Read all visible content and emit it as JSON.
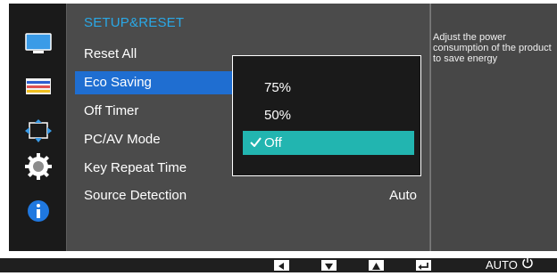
{
  "section_title": "SETUP&RESET",
  "menu_items": [
    {
      "label": "Reset All"
    },
    {
      "label": "Eco Saving"
    },
    {
      "label": "Off Timer"
    },
    {
      "label": "PC/AV Mode"
    },
    {
      "label": "Key Repeat Time"
    },
    {
      "label": "Source Detection",
      "value": "Auto"
    }
  ],
  "submenu": {
    "options": [
      "75%",
      "50%",
      "Off"
    ],
    "selected": "Off"
  },
  "help_text": "Adjust the power consumption of the product to save energy",
  "left_icons": [
    "picture-icon",
    "color-icon",
    "size-position-icon",
    "setup-reset-icon",
    "information-icon"
  ],
  "bottom_buttons": [
    "left-arrow-icon",
    "down-arrow-icon",
    "up-arrow-icon",
    "enter-icon",
    "AUTO",
    "power-icon"
  ],
  "bottom_auto_label": "AUTO",
  "colors": {
    "accent_blue": "#1f6ed1",
    "selection_teal": "#22b5b0",
    "title_blue": "#2aa8e6"
  }
}
